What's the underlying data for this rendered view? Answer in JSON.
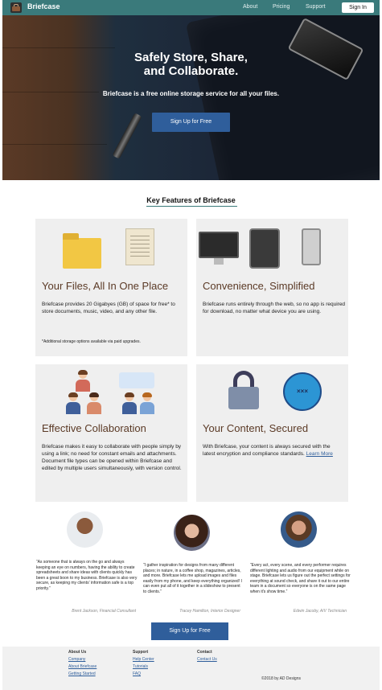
{
  "header": {
    "brand": "Briefcase",
    "nav": [
      "About",
      "Pricing",
      "Support"
    ],
    "signin": "Sign In"
  },
  "hero": {
    "title_line1": "Safely Store, Share,",
    "title_line2": "and Collaborate.",
    "subtitle": "Briefcase is a free online storage service for all your files.",
    "button": "Sign Up for Free"
  },
  "features": {
    "title": "Key Features of Briefcase",
    "cards": [
      {
        "title": "Your Files, All In One Place",
        "text": "Briefcase provides 20 Gigabyes (GB) of space for free* to store documents, music, video, and any other file.",
        "note": "*Additional storage options available via paid upgrades."
      },
      {
        "title": "Convenience, Simplified",
        "text": "Briefcase runs entirely through the web, so no app is required for download, no matter what device you are using."
      },
      {
        "title": "Effective Collaboration",
        "text": "Briefcase makes it easy to collaborate with people simply by using a link; no need for constant emails and attachments. Document file types can be opened within Briefcase and edited by multiple users simultaneously, with version control."
      },
      {
        "title": "Your Content, Secured",
        "text": "With Briefcase, your content is always secured with the latest encryption and compliance standards.",
        "link": "Learn More",
        "badge": "×××"
      }
    ]
  },
  "testimonials": [
    {
      "quote": "“As someone that is always on the go and always keeping an eye on numbers, having the ability to create spreadsheets and share ideas with clients quickly has been a great boon to my business. Briefcase is also very secure, as keeping my clients' information safe is a top priority.”",
      "author": "Brent Jackson, Financial Consultant"
    },
    {
      "quote": "“I gather inspiration for designs from many different places; in nature, in a coffee shop, magazines, articles, and more. Briefcase lets me upload images and files easily from my phone, and keep everything organized! I can even put all of it together in a slideshow to present to clients.”",
      "author": "Tracey Hamilton, Interior Designer"
    },
    {
      "quote": "“Every act, every scene, and every performer requires different lighting and audio from our equipment while on stage. Briefcase lets us figure out the perfect settings for everything at sound check, and share it out to our entire team in a document so everyone is on the same page when it's show time.”",
      "author": "Edwin Jacoby, A/V Technician"
    }
  ],
  "cta": "Sign Up for Free",
  "footer": {
    "about": {
      "heading": "About Us",
      "links": [
        "Company",
        "About Briefcase",
        "Getting Started"
      ]
    },
    "support": {
      "heading": "Support",
      "links": [
        "Help Center",
        "Tutorials",
        "FAQ"
      ]
    },
    "contact": {
      "heading": "Contact",
      "links": [
        "Contact Us"
      ]
    },
    "copyright": "©2018 by AD Designs"
  },
  "colors": {
    "teal": "#3a7a7b",
    "button_blue": "#2f5e9b",
    "heading_brown": "#5b3a26",
    "card_bg": "#efefef"
  },
  "icons": [
    "briefcase-logo-icon",
    "folder-icon",
    "document-icon",
    "monitor-icon",
    "tablet-icon",
    "phone-icon",
    "team-icon",
    "chat-bubble-icon",
    "padlock-icon",
    "password-badge-icon"
  ]
}
